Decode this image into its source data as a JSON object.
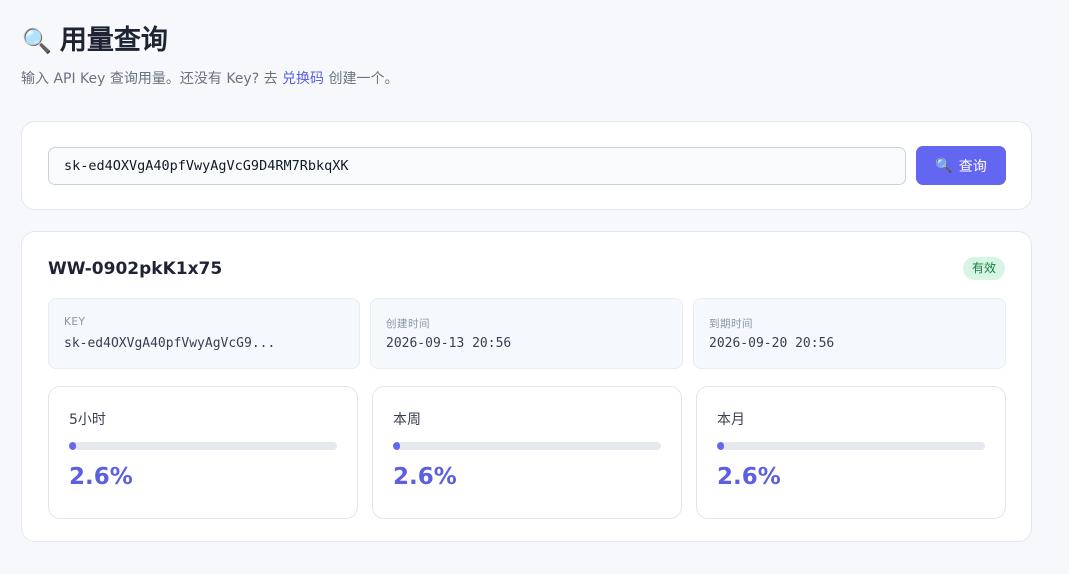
{
  "header": {
    "title": "用量查询",
    "subtitle_prefix": "输入 API Key 查询用量。还没有 Key? 去 ",
    "subtitle_link": "兑换码",
    "subtitle_suffix": " 创建一个。"
  },
  "search": {
    "value": "sk-ed4OXVgA40pfVwyAgVcG9D4RM7RbkqXK",
    "button_label": "查询"
  },
  "result": {
    "code": "WW-0902pkK1x75",
    "status": "有效",
    "info": [
      {
        "label": "KEY",
        "value": "sk-ed4OXVgA40pfVwyAgVcG9..."
      },
      {
        "label": "创建时间",
        "value": "2026-09-13 20:56"
      },
      {
        "label": "到期时间",
        "value": "2026-09-20 20:56"
      }
    ],
    "usage": [
      {
        "label": "5小时",
        "value": "2.6%",
        "percent": 2.6
      },
      {
        "label": "本周",
        "value": "2.6%",
        "percent": 2.6
      },
      {
        "label": "本月",
        "value": "2.6%",
        "percent": 2.6
      }
    ]
  },
  "colors": {
    "accent": "#6366f1",
    "status_bg": "#d7f5e4",
    "status_text": "#15803d"
  },
  "icons": {
    "title": "magnifier-icon",
    "button": "magnifier-icon"
  }
}
